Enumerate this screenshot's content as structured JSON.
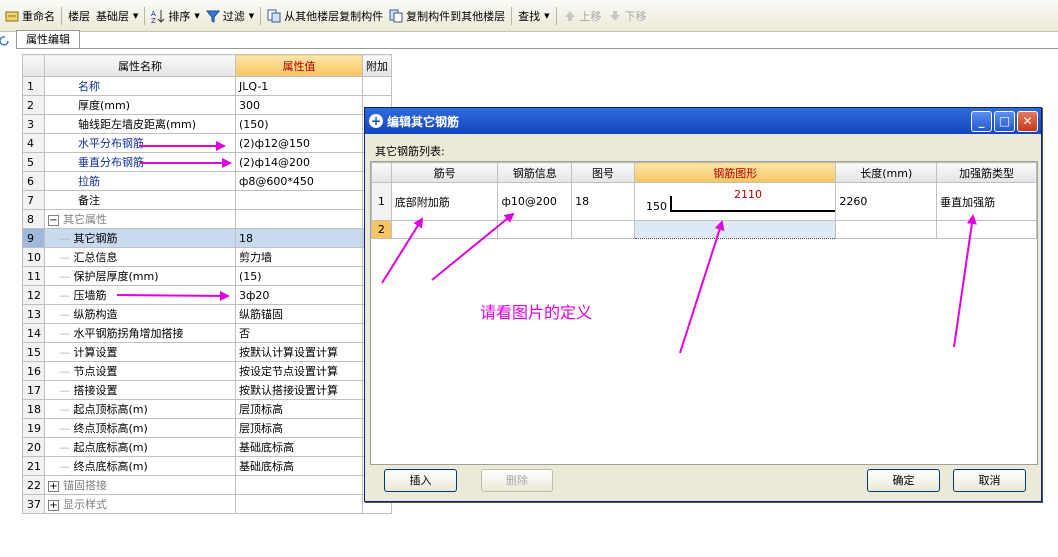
{
  "toolbar": {
    "rename": "重命名",
    "floor_label": "楼层",
    "floor_value": "基础层",
    "sort": "排序",
    "filter": "过滤",
    "copy_from": "从其他楼层复制构件",
    "copy_to": "复制构件到其他楼层",
    "find": "查找",
    "move_up": "上移",
    "move_down": "下移"
  },
  "tab": {
    "label": "属性编辑"
  },
  "property_grid": {
    "headers": [
      "属性名称",
      "属性值",
      "附加"
    ],
    "rows": [
      {
        "num": "1",
        "name": "名称",
        "value": "JLQ-1"
      },
      {
        "num": "2",
        "name": "厚度(mm)",
        "value": "300"
      },
      {
        "num": "3",
        "name": "轴线距左墙皮距离(mm)",
        "value": "(150)"
      },
      {
        "num": "4",
        "name": "水平分布钢筋",
        "value": "(2)ф12@150"
      },
      {
        "num": "5",
        "name": "垂直分布钢筋",
        "value": "(2)ф14@200"
      },
      {
        "num": "6",
        "name": "拉筋",
        "value": "ф8@600*450"
      },
      {
        "num": "7",
        "name": "备注",
        "value": ""
      },
      {
        "num": "8",
        "name": "其它属性",
        "value": ""
      },
      {
        "num": "9",
        "name": "其它钢筋",
        "value": "18"
      },
      {
        "num": "10",
        "name": "汇总信息",
        "value": "剪力墙"
      },
      {
        "num": "11",
        "name": "保护层厚度(mm)",
        "value": "(15)"
      },
      {
        "num": "12",
        "name": "压墙筋",
        "value": "3ф20"
      },
      {
        "num": "13",
        "name": "纵筋构造",
        "value": "纵筋锚固"
      },
      {
        "num": "14",
        "name": "水平钢筋拐角增加搭接",
        "value": "否"
      },
      {
        "num": "15",
        "name": "计算设置",
        "value": "按默认计算设置计算"
      },
      {
        "num": "16",
        "name": "节点设置",
        "value": "按设定节点设置计算"
      },
      {
        "num": "17",
        "name": "搭接设置",
        "value": "按默认搭接设置计算"
      },
      {
        "num": "18",
        "name": "起点顶标高(m)",
        "value": "层顶标高"
      },
      {
        "num": "19",
        "name": "终点顶标高(m)",
        "value": "层顶标高"
      },
      {
        "num": "20",
        "name": "起点底标高(m)",
        "value": "基础底标高"
      },
      {
        "num": "21",
        "name": "终点底标高(m)",
        "value": "基础底标高"
      },
      {
        "num": "22",
        "name": "锚固搭接",
        "value": ""
      },
      {
        "num": "37",
        "name": "显示样式",
        "value": ""
      }
    ]
  },
  "dialog": {
    "title": "编辑其它钢筋",
    "list_label": "其它钢筋列表:",
    "headers": [
      "筋号",
      "钢筋信息",
      "图号",
      "钢筋图形",
      "长度(mm)",
      "加强筋类型"
    ],
    "rows": [
      {
        "num": "1",
        "bar_no": "底部附加筋",
        "info": "ф10@200",
        "fig": "18",
        "shape_len": "150",
        "shape_val": "2110",
        "length": "2260",
        "type": "垂直加强筋"
      },
      {
        "num": "2",
        "bar_no": "",
        "info": "",
        "fig": "",
        "shape_len": "",
        "shape_val": "",
        "length": "",
        "type": ""
      }
    ],
    "buttons": {
      "insert": "插入",
      "delete": "删除",
      "ok": "确定",
      "cancel": "取消"
    }
  },
  "annotation": {
    "text": "请看图片的定义",
    "color": "#e000e0"
  }
}
